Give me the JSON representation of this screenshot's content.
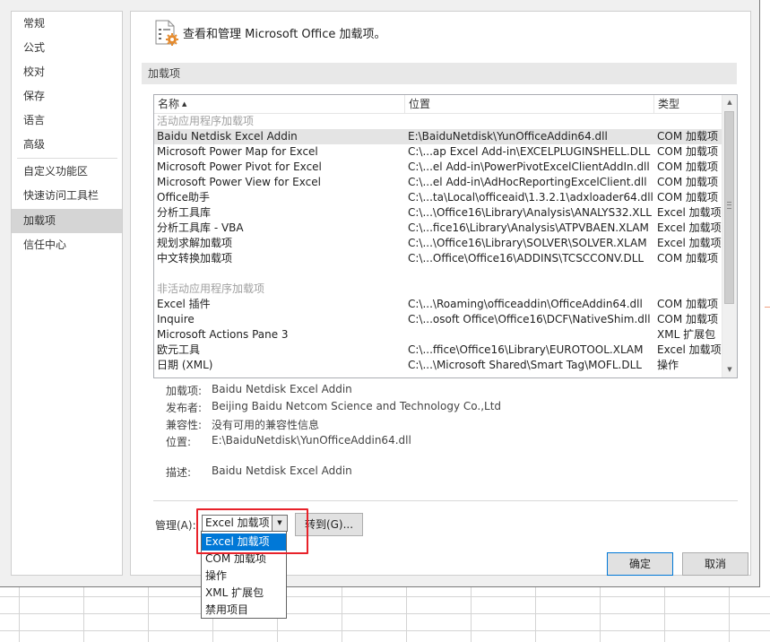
{
  "nav": {
    "items": [
      {
        "label": "常规"
      },
      {
        "label": "公式"
      },
      {
        "label": "校对"
      },
      {
        "label": "保存"
      },
      {
        "label": "语言"
      },
      {
        "label": "高级"
      },
      {
        "label": "自定义功能区"
      },
      {
        "label": "快速访问工具栏"
      },
      {
        "label": "加载项"
      },
      {
        "label": "信任中心"
      }
    ],
    "selected": "加载项"
  },
  "header": {
    "icon": "addin-gear-icon",
    "title": "查看和管理 Microsoft Office 加载项。"
  },
  "section": {
    "title": "加载项"
  },
  "list": {
    "columns": {
      "name": "名称",
      "sort_indicator": "▲",
      "location": "位置",
      "type": "类型"
    },
    "groups": {
      "active": "活动应用程序加载项",
      "inactive": "非活动应用程序加载项"
    },
    "active_rows": [
      {
        "name": "Baidu Netdisk Excel Addin",
        "location": "E:\\BaiduNetdisk\\YunOfficeAddin64.dll",
        "type": "COM 加载项"
      },
      {
        "name": "Microsoft Power Map for Excel",
        "location": "C:\\...ap Excel Add-in\\EXCELPLUGINSHELL.DLL",
        "type": "COM 加载项"
      },
      {
        "name": "Microsoft Power Pivot for Excel",
        "location": "C:\\...el Add-in\\PowerPivotExcelClientAddIn.dll",
        "type": "COM 加载项"
      },
      {
        "name": "Microsoft Power View for Excel",
        "location": "C:\\...el Add-in\\AdHocReportingExcelClient.dll",
        "type": "COM 加载项"
      },
      {
        "name": "Office助手",
        "location": "C:\\...ta\\Local\\officeaid\\1.3.2.1\\adxloader64.dll",
        "type": "COM 加载项"
      },
      {
        "name": "分析工具库",
        "location": "C:\\...\\Office16\\Library\\Analysis\\ANALYS32.XLL",
        "type": "Excel 加载项"
      },
      {
        "name": "分析工具库 - VBA",
        "location": "C:\\...fice16\\Library\\Analysis\\ATPVBAEN.XLAM",
        "type": "Excel 加载项"
      },
      {
        "name": "规划求解加载项",
        "location": "C:\\...\\Office16\\Library\\SOLVER\\SOLVER.XLAM",
        "type": "Excel 加载项"
      },
      {
        "name": "中文转换加载项",
        "location": "C:\\...Office\\Office16\\ADDINS\\TCSCCONV.DLL",
        "type": "COM 加载项"
      }
    ],
    "inactive_rows": [
      {
        "name": "Excel 插件",
        "location": "C:\\...\\Roaming\\officeaddin\\OfficeAddin64.dll",
        "type": "COM 加载项"
      },
      {
        "name": "Inquire",
        "location": "C:\\...osoft Office\\Office16\\DCF\\NativeShim.dll",
        "type": "COM 加载项"
      },
      {
        "name": "Microsoft Actions Pane 3",
        "location": "",
        "type": "XML 扩展包"
      },
      {
        "name": "欧元工具",
        "location": "C:\\...ffice\\Office16\\Library\\EUROTOOL.XLAM",
        "type": "Excel 加载项"
      },
      {
        "name": "日期 (XML)",
        "location": "C:\\...\\Microsoft Shared\\Smart Tag\\MOFL.DLL",
        "type": "操作"
      }
    ],
    "selected_row": "Baidu Netdisk Excel Addin"
  },
  "details": {
    "addin_label": "加载项:",
    "addin_value": "Baidu Netdisk Excel Addin",
    "publisher_label": "发布者:",
    "publisher_value": "Beijing Baidu Netcom Science and Technology Co.,Ltd",
    "compat_label": "兼容性:",
    "compat_value": "没有可用的兼容性信息",
    "location_label": "位置:",
    "location_value": "E:\\BaiduNetdisk\\YunOfficeAddin64.dll",
    "desc_label": "描述:",
    "desc_value": "Baidu Netdisk Excel Addin"
  },
  "manage": {
    "label": "管理(A):",
    "selected": "Excel 加载项",
    "goto_label": "转到(G)...",
    "options": [
      "Excel 加载项",
      "COM 加载项",
      "操作",
      "XML 扩展包",
      "禁用项目"
    ],
    "highlighted": "Excel 加载项"
  },
  "buttons": {
    "ok": "确定",
    "cancel": "取消"
  },
  "colors": {
    "highlight": "#0078d7",
    "annotation": "#e8222a",
    "selected_row": "#e4e4e4"
  }
}
